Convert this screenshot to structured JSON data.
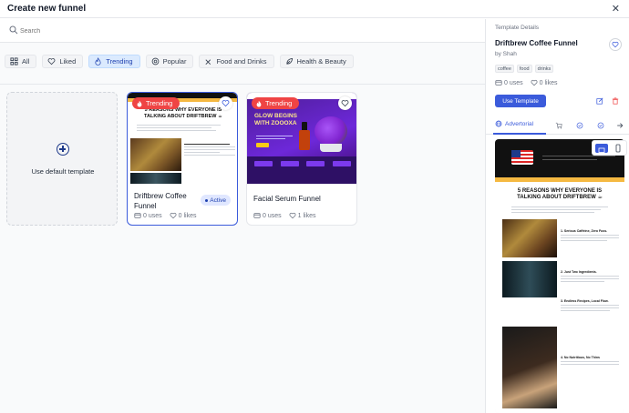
{
  "header": {
    "title": "Create new funnel",
    "close_icon": "close-icon"
  },
  "search": {
    "placeholder": "Search"
  },
  "filters": [
    {
      "label": "All",
      "icon": "grid-icon",
      "active": false
    },
    {
      "label": "Liked",
      "icon": "heart-icon",
      "active": false
    },
    {
      "label": "Trending",
      "icon": "fire-icon",
      "active": true
    },
    {
      "label": "Popular",
      "icon": "target-icon",
      "active": false
    },
    {
      "label": "Food and Drinks",
      "icon": "utensils-icon",
      "active": false
    },
    {
      "label": "Health & Beauty",
      "icon": "leaf-icon",
      "active": false
    }
  ],
  "default_card": {
    "label": "Use default template"
  },
  "cards": [
    {
      "name": "Driftbrew Coffee Funnel",
      "badge": "Trending",
      "status": "Active",
      "uses": "0 uses",
      "likes": "0 likes",
      "thumb_headline": "5 REASONS WHY EVERYONE IS TALKING ABOUT DRIFTBREW ☕"
    },
    {
      "name": "Facial Serum Funnel",
      "badge": "Trending",
      "uses": "0 uses",
      "likes": "1 likes",
      "thumb_headline": "GLOW BEGINS WITH ZOOOXA"
    }
  ],
  "details": {
    "section_label": "Template Details",
    "name": "Driftbrew Coffee Funnel",
    "author": "by Shah",
    "tags": [
      "coffee",
      "food",
      "drinks"
    ],
    "uses": "0 uses",
    "likes": "0 likes",
    "use_button": "Use Template",
    "tab_active": "Advertorial",
    "preview_headline": "5 REASONS WHY EVERYONE IS TALKING ABOUT DRIFTBREW ☕",
    "preview_sections": [
      "1. Serious Caffeine, Zero Fuss.",
      "2. Just Two Ingredients.",
      "3. Endless Recipes, Local Flow.",
      "4. No Nutritious, No Thins"
    ]
  },
  "colors": {
    "accent": "#3b5bdb",
    "trending": "#ef4444",
    "active_bg": "#e0e7ff"
  }
}
